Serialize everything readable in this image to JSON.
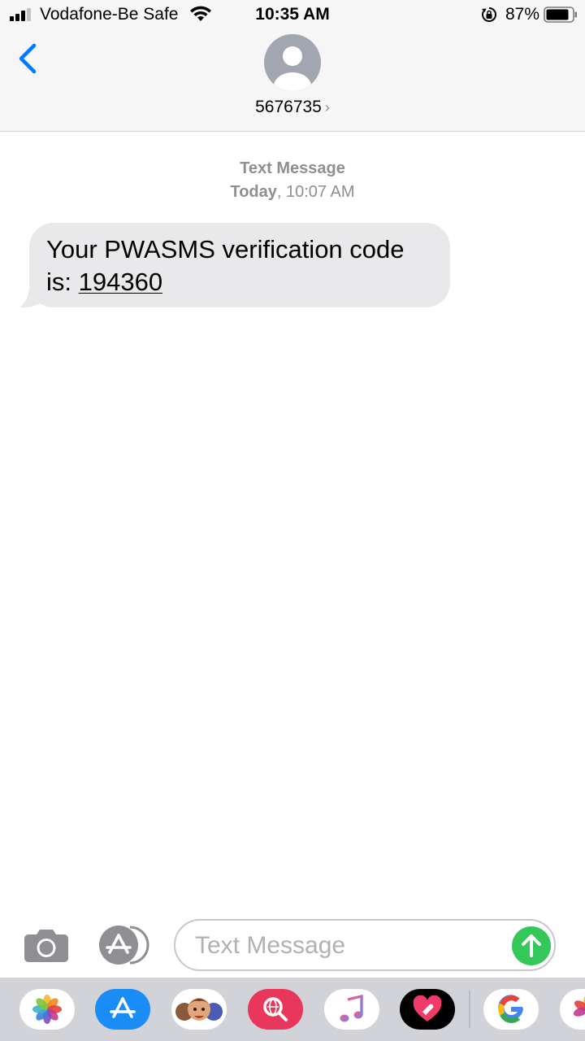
{
  "status_bar": {
    "carrier": "Vodafone-Be Safe",
    "time": "10:35 AM",
    "battery_percent": "87%",
    "battery_level": 0.87,
    "signal_bars": 3,
    "icons": [
      "signal-icon",
      "wifi-icon",
      "rotation-lock-icon",
      "battery-icon"
    ]
  },
  "header": {
    "contact": "5676735",
    "chevron": "›",
    "icons": [
      "back-chevron-icon",
      "contact-avatar-icon"
    ]
  },
  "conversation": {
    "message_type": "Text Message",
    "date_label": "Today",
    "time_label": ", 10:07 AM",
    "messages": [
      {
        "direction": "incoming",
        "text_line1": "Your PWASMS verification code",
        "text_prefix": "is: ",
        "code": "194360"
      }
    ]
  },
  "compose": {
    "placeholder": "Text Message",
    "value": "",
    "icons": [
      "camera-icon",
      "app-store-icon",
      "send-arrow-icon"
    ]
  },
  "app_drawer": {
    "apps": [
      "photos-icon",
      "app-store-icon",
      "memoji-icon",
      "web-search-icon",
      "music-icon",
      "digital-touch-icon",
      "google-icon",
      "photos-partial-icon"
    ]
  },
  "colors": {
    "accent_blue": "#007aff",
    "bubble_gray": "#e9e9eb",
    "send_green": "#34c759",
    "secondary_text": "#8e8e93",
    "bar_background": "#f6f6f6",
    "drawer_background": "#d1d3d9"
  }
}
